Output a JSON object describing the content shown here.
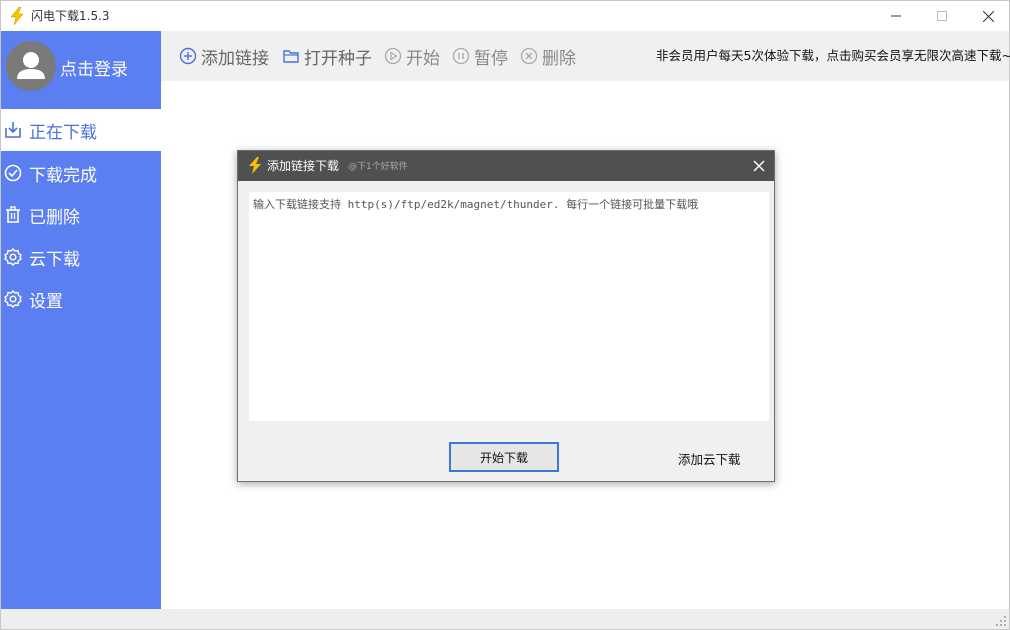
{
  "window": {
    "title": "闪电下载1.5.3",
    "icon": "lightning-icon"
  },
  "colors": {
    "sidebar_bg": "#5b7ff0",
    "active_text": "#4a6fe0",
    "dialog_title_bg": "#505050",
    "button_border": "#3b78d8"
  },
  "sidebar": {
    "login_label": "点击登录",
    "items": [
      {
        "label": "正在下载",
        "icon": "download-tray-icon",
        "active": true
      },
      {
        "label": "下载完成",
        "icon": "check-circle-icon",
        "active": false
      },
      {
        "label": "已删除",
        "icon": "trash-icon",
        "active": false
      },
      {
        "label": "云下载",
        "icon": "gear-icon",
        "active": false
      },
      {
        "label": "设置",
        "icon": "gear-icon",
        "active": false
      }
    ]
  },
  "toolbar": {
    "add_link": "添加链接",
    "open_torrent": "打开种子",
    "start": "开始",
    "pause": "暂停",
    "delete": "删除",
    "notice": "非会员用户每天5次体验下载，点击购买会员享无限次高速下载~"
  },
  "dialog": {
    "title": "添加链接下载",
    "watermark": "@下1个好软件",
    "placeholder": "输入下载链接支持 http(s)/ftp/ed2k/magnet/thunder. 每行一个链接可批量下载哦",
    "start_button": "开始下载",
    "cloud_link": "添加云下载"
  }
}
